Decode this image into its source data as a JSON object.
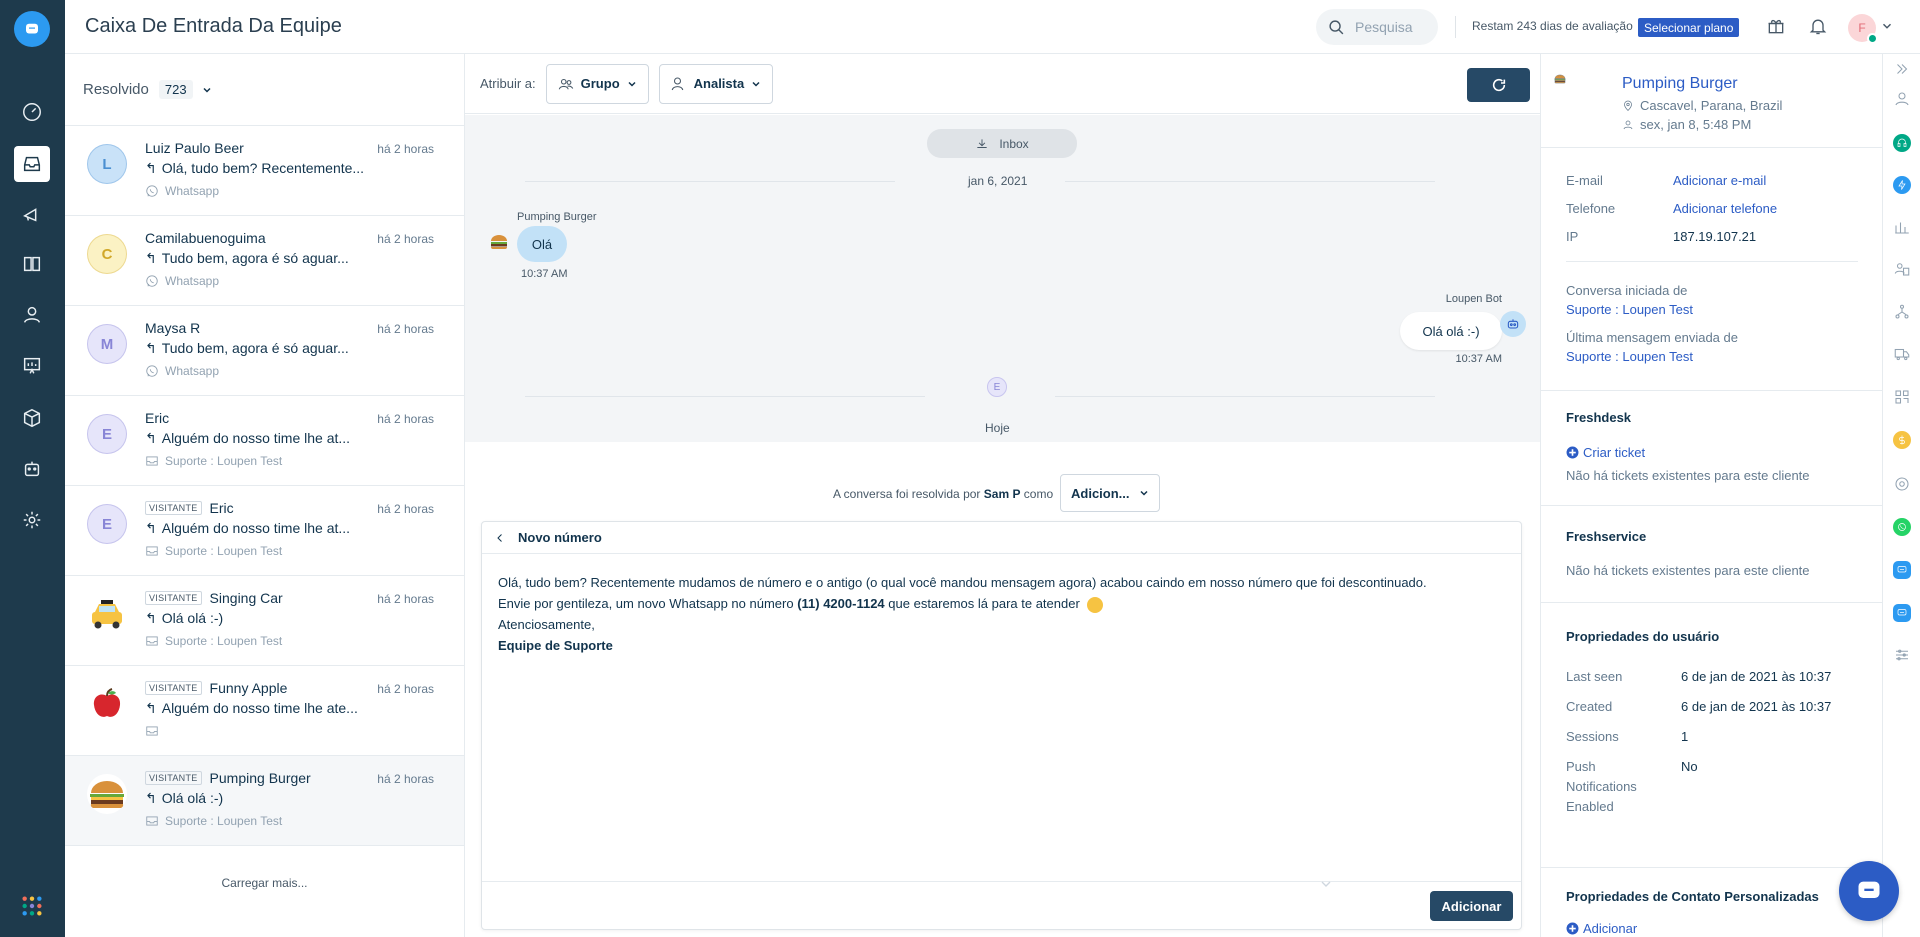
{
  "header": {
    "title": "Caixa De Entrada Da Equipe",
    "search_placeholder": "Pesquisa",
    "trial_text": "Restam 243 dias de avaliação",
    "plan_button": "Selecionar plano",
    "user_initial": "F"
  },
  "list": {
    "filter_label": "Resolvido",
    "filter_count": "723",
    "load_more": "Carregar mais...",
    "items": [
      {
        "initial": "L",
        "name": "Luiz Paulo Beer",
        "visitor": "",
        "time": "há 2 horas",
        "message": "Olá, tudo bem? Recentemente...",
        "source": "Whatsapp",
        "avatar_bg": "#c9e2f8",
        "avatar_fg": "#4b8fd1"
      },
      {
        "initial": "C",
        "name": "Camilabuenoguima",
        "visitor": "",
        "time": "há 2 horas",
        "message": "Tudo bem, agora é só aguar...",
        "source": "Whatsapp",
        "avatar_bg": "#fbf2c4",
        "avatar_fg": "#d1a82a"
      },
      {
        "initial": "M",
        "name": "Maysa R",
        "visitor": "",
        "time": "há 2 horas",
        "message": "Tudo bem, agora é só aguar...",
        "source": "Whatsapp",
        "avatar_bg": "#e6e5fa",
        "avatar_fg": "#8885d6"
      },
      {
        "initial": "E",
        "name": "Eric",
        "visitor": "",
        "time": "há 2 horas",
        "message": "Alguém do nosso time lhe at...",
        "source": "Suporte : Loupen Test",
        "avatar_bg": "#e6e5fa",
        "avatar_fg": "#8885d6"
      },
      {
        "initial": "E",
        "name": "Eric",
        "visitor": "VISITANTE",
        "time": "há 2 horas",
        "message": "Alguém do nosso time lhe at...",
        "source": "Suporte : Loupen Test",
        "avatar_bg": "#e6e5fa",
        "avatar_fg": "#8885d6"
      },
      {
        "initial": "",
        "name": "Singing Car",
        "visitor": "VISITANTE",
        "time": "há 2 horas",
        "message": "Olá olá :-)",
        "source": "Suporte : Loupen Test",
        "avatar_bg": "#ffffff",
        "avatar_fg": "#000000"
      },
      {
        "initial": "",
        "name": "Funny Apple",
        "visitor": "VISITANTE",
        "time": "há 2 horas",
        "message": "Alguém do nosso time lhe ate...",
        "source": "",
        "avatar_bg": "#ffffff",
        "avatar_fg": "#000000"
      },
      {
        "initial": "",
        "name": "Pumping Burger",
        "visitor": "VISITANTE",
        "time": "há 2 horas",
        "message": "Olá olá :-)",
        "source": "Suporte : Loupen Test",
        "avatar_bg": "#ffffff",
        "avatar_fg": "#000000"
      }
    ]
  },
  "assign": {
    "label": "Atribuir a:",
    "group": "Grupo",
    "agent": "Analista"
  },
  "chat": {
    "inbox_label": "Inbox",
    "date1": "jan 6, 2021",
    "in_sender": "Pumping Burger",
    "in_message": "Olá",
    "in_time": "10:37 AM",
    "out_sender": "Loupen Bot",
    "out_message": "Olá olá :-)",
    "out_time": "10:37 AM",
    "event_initial": "E",
    "date2": "Hoje",
    "resolved_prefix": "A conversa foi resolvida por",
    "resolved_by": "Sam P",
    "resolved_suffix": "como",
    "resolved_select": "Adicion..."
  },
  "composer": {
    "title": "Novo número",
    "line1": "Olá, tudo bem? Recentemente mudamos de número e o antigo (o qual você mandou mensagem agora) acabou caindo em nosso número que foi descontinuado.",
    "line2_pre": "Envie por gentileza, um novo Whatsapp no número",
    "line2_number": "(11) 4200-1124",
    "line2_post": "que estaremos lá para te atender",
    "line3": "Atenciosamente,",
    "line4": "Equipe de Suporte",
    "submit": "Adicionar"
  },
  "contact": {
    "name": "Pumping Burger",
    "location": "Cascavel, Parana, Brazil",
    "localtime": "sex, jan 8, 5:48 PM",
    "email_label": "E-mail",
    "email_value": "Adicionar e-mail",
    "phone_label": "Telefone",
    "phone_value": "Adicionar telefone",
    "ip_label": "IP",
    "ip_value": "187.19.107.21",
    "started_label": "Conversa iniciada de",
    "started_value": "Suporte : Loupen Test",
    "last_label": "Última mensagem enviada de",
    "last_value": "Suporte : Loupen Test"
  },
  "freshdesk": {
    "title": "Freshdesk",
    "action": "Criar ticket",
    "empty": "Não há tickets existentes para este cliente"
  },
  "freshservice": {
    "title": "Freshservice",
    "empty": "Não há tickets existentes para este cliente"
  },
  "user_props": {
    "title": "Propriedades do usuário",
    "rows": [
      {
        "label": "Last seen",
        "value": "6 de jan de 2021 às 10:37"
      },
      {
        "label": "Created",
        "value": "6 de jan de 2021 às 10:37"
      },
      {
        "label": "Sessions",
        "value": "1"
      },
      {
        "label": "Push Notifications Enabled",
        "value": "No"
      }
    ]
  },
  "custom_props": {
    "title": "Propriedades de Contato Personalizadas",
    "action": "Adicionar"
  },
  "colors": {
    "rail": "#1e3a4c",
    "link": "#2c5cc5",
    "primary_button": "#264966",
    "bubble_in": "#c2e1f7"
  }
}
